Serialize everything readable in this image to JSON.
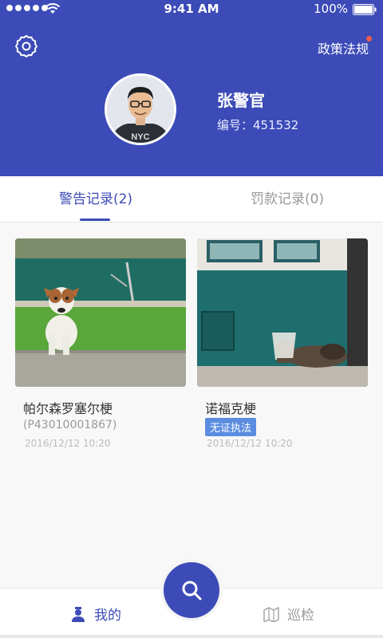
{
  "status_bar": {
    "time": "9:41 AM",
    "battery": "100%"
  },
  "header": {
    "policy_label": "政策法规",
    "user_name": "张警官",
    "badge_label": "编号：",
    "badge_number": "451532"
  },
  "tabs": [
    {
      "label": "警告记录(2)",
      "active": true
    },
    {
      "label": "罚款记录(0)",
      "active": false
    }
  ],
  "records": [
    {
      "title": "帕尔森罗塞尔梗",
      "sub": "(P43010001867)",
      "date": "2016/12/12 10:20"
    },
    {
      "title": "诺福克梗",
      "tag": "无证执法",
      "date": "2016/12/12 10:20"
    }
  ],
  "bottom_nav": {
    "mine_label": "我的",
    "patrol_label": "巡检"
  },
  "colors": {
    "primary": "#3c4bb7",
    "tag": "#5b8ce0",
    "notice_dot": "#ef5b4c"
  }
}
